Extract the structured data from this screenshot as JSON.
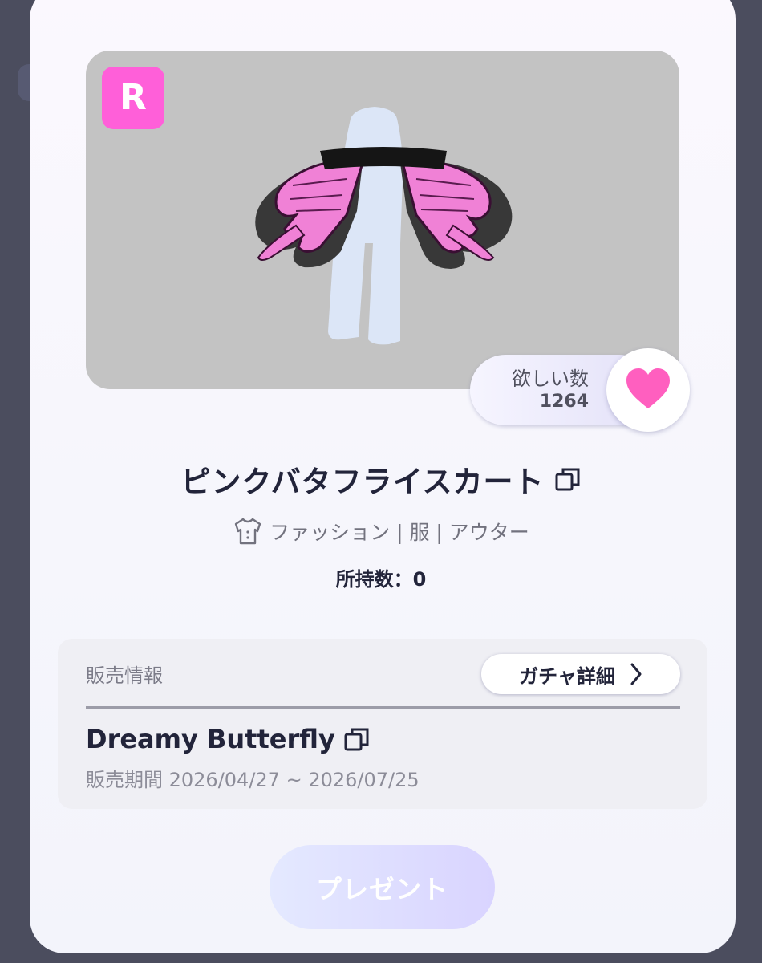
{
  "item": {
    "rarity": "R",
    "name": "ピンクバタフライスカート",
    "category": "ファッション | 服 | アウター",
    "owned": "所持数：0"
  },
  "wish": {
    "label": "欲しい数",
    "count": "1264"
  },
  "sales": {
    "label": "販売情報",
    "gacha_button": "ガチャ詳細",
    "gacha_name": "Dreamy Butterfly",
    "period": "販売期間 2026/04/27 ~ 2026/07/25"
  },
  "actions": {
    "present": "プレゼント"
  },
  "colors": {
    "rarity_badge": "#ff5fd9",
    "heart": "#ff5fbf",
    "preview_bg": "#c3c3c3"
  },
  "icons": [
    "copy-icon",
    "heart-icon",
    "shirt-icon",
    "chevron-right-icon"
  ]
}
